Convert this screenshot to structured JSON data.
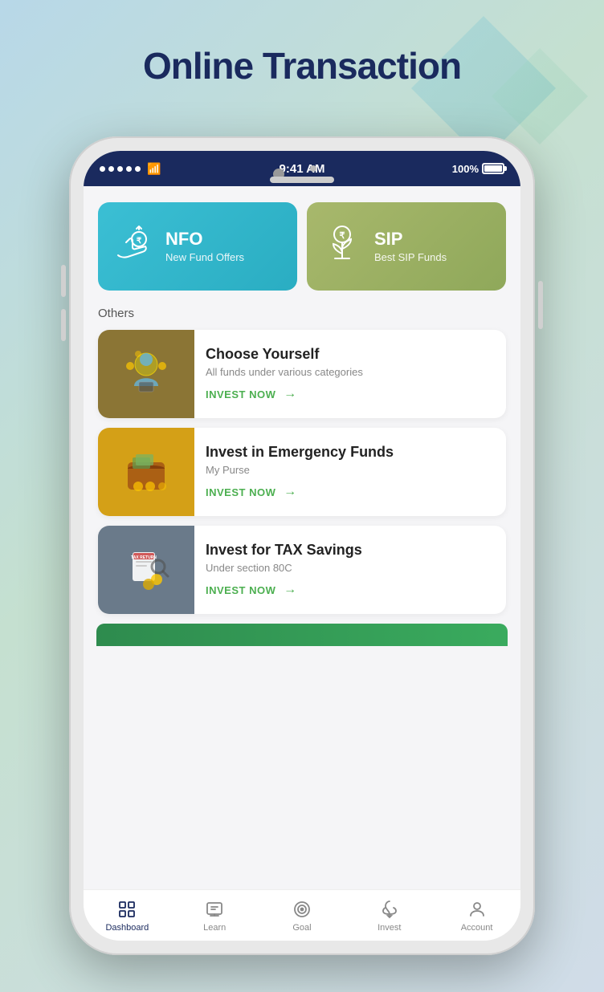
{
  "page": {
    "title": "Online Transaction",
    "background_gradient": "#b8d8e8, #c5e0d0"
  },
  "status_bar": {
    "time": "9:41 AM",
    "battery": "100%",
    "signal_dots": 5
  },
  "fund_cards": [
    {
      "id": "nfo",
      "title": "NFO",
      "subtitle": "New Fund Offers",
      "color": "#3bbfd4",
      "icon": "nfo-icon"
    },
    {
      "id": "sip",
      "title": "SIP",
      "subtitle": "Best SIP Funds",
      "color": "#a8b86c",
      "icon": "sip-icon"
    }
  ],
  "others_label": "Others",
  "invest_cards": [
    {
      "id": "choose-yourself",
      "title": "Choose Yourself",
      "subtitle": "All funds under various categories",
      "cta": "INVEST NOW",
      "bg_color": "#8b7535"
    },
    {
      "id": "emergency-funds",
      "title": "Invest in Emergency Funds",
      "subtitle": "My Purse",
      "cta": "INVEST NOW",
      "bg_color": "#d4a017"
    },
    {
      "id": "tax-savings",
      "title": "Invest for TAX Savings",
      "subtitle": "Under section 80C",
      "cta": "INVEST NOW",
      "bg_color": "#6a7a8a"
    }
  ],
  "bottom_nav": [
    {
      "id": "dashboard",
      "label": "Dashboard",
      "active": true
    },
    {
      "id": "learn",
      "label": "Learn",
      "active": false
    },
    {
      "id": "goal",
      "label": "Goal",
      "active": false
    },
    {
      "id": "invest",
      "label": "Invest",
      "active": false
    },
    {
      "id": "account",
      "label": "Account",
      "active": false
    }
  ]
}
